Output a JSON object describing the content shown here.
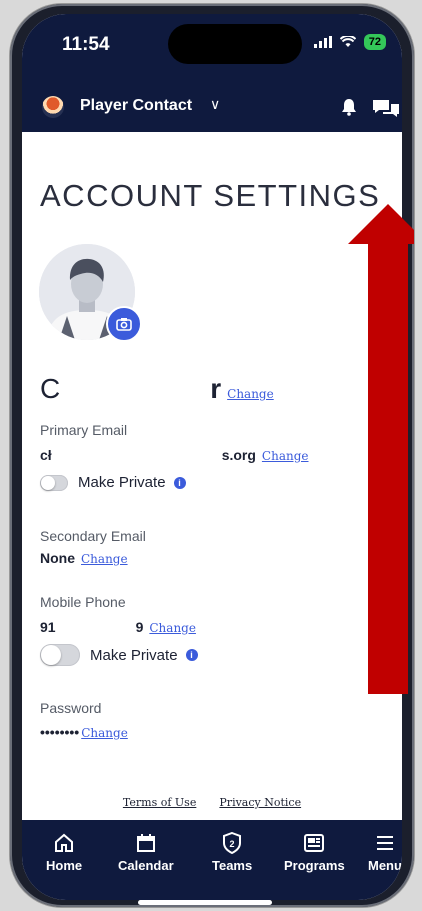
{
  "status": {
    "time": "11:54",
    "battery": "72"
  },
  "topnav": {
    "team_name": "Player Contact",
    "dropdown": "∨"
  },
  "page": {
    "title": "ACCOUNT SETTINGS"
  },
  "profile": {
    "name_first": "C",
    "name_last": "r",
    "change": "Change"
  },
  "primary_email": {
    "label": "Primary Email",
    "value_start": "cł",
    "value_end": "s.org",
    "change": "Change",
    "private_label": "Make Private"
  },
  "secondary_email": {
    "label": "Secondary Email",
    "value": "None",
    "change": "Change"
  },
  "mobile_phone": {
    "label": "Mobile Phone",
    "value_start": "91",
    "value_end": "9",
    "change": "Change",
    "private_label": "Make Private"
  },
  "password": {
    "label": "Password",
    "value": "••••••••",
    "change": "Change"
  },
  "footer": {
    "terms": "Terms of Use",
    "privacy": "Privacy Notice"
  },
  "tabs": [
    {
      "label": "Home",
      "icon": "home-icon"
    },
    {
      "label": "Calendar",
      "icon": "calendar-icon"
    },
    {
      "label": "Teams",
      "icon": "teams-icon"
    },
    {
      "label": "Programs",
      "icon": "programs-icon"
    },
    {
      "label": "Menu",
      "icon": "menu-icon"
    }
  ],
  "colors": {
    "navy": "#0f1a3e",
    "link": "#3b5bdb",
    "arrow": "#c00000"
  }
}
